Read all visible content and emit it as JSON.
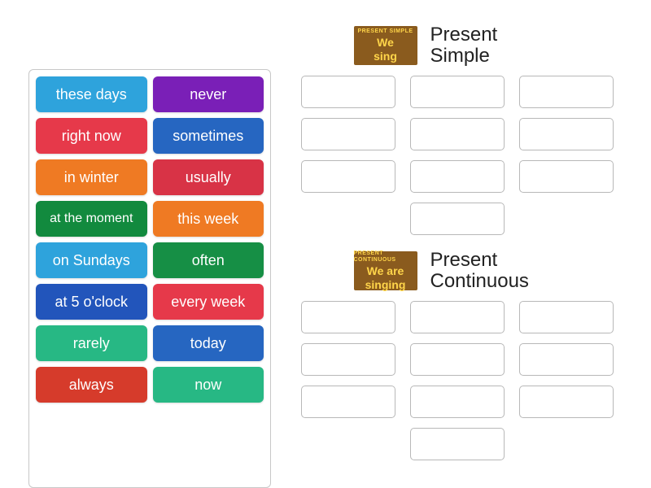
{
  "words": [
    {
      "label": "these days",
      "color": "#2ea3dc"
    },
    {
      "label": "never",
      "color": "#7a1fb7"
    },
    {
      "label": "right now",
      "color": "#e6394a"
    },
    {
      "label": "sometimes",
      "color": "#2666c1"
    },
    {
      "label": "in winter",
      "color": "#ef7a23"
    },
    {
      "label": "usually",
      "color": "#d83346"
    },
    {
      "label": "at the moment",
      "color": "#128a3e"
    },
    {
      "label": "this week",
      "color": "#ef7a23"
    },
    {
      "label": "on Sundays",
      "color": "#2ea3dc"
    },
    {
      "label": "often",
      "color": "#168f45"
    },
    {
      "label": "at 5 o'clock",
      "color": "#2255bb"
    },
    {
      "label": "every week",
      "color": "#e6394a"
    },
    {
      "label": "rarely",
      "color": "#27b884"
    },
    {
      "label": "today",
      "color": "#2666c1"
    },
    {
      "label": "always",
      "color": "#d63b2b"
    },
    {
      "label": "now",
      "color": "#27b884"
    }
  ],
  "sections": {
    "simple": {
      "title": "Present Simple",
      "badge": {
        "top": "PRESENT SIMPLE",
        "line1": "We",
        "line2": "sing",
        "bg": "#8a5b1e"
      },
      "slotCount": 10
    },
    "continuous": {
      "title": "Present Continuous",
      "badge": {
        "top": "PRESENT CONTINUOUS",
        "line1": "We are",
        "line2": "singing",
        "bg": "#8a5b1e"
      },
      "slotCount": 10
    }
  }
}
